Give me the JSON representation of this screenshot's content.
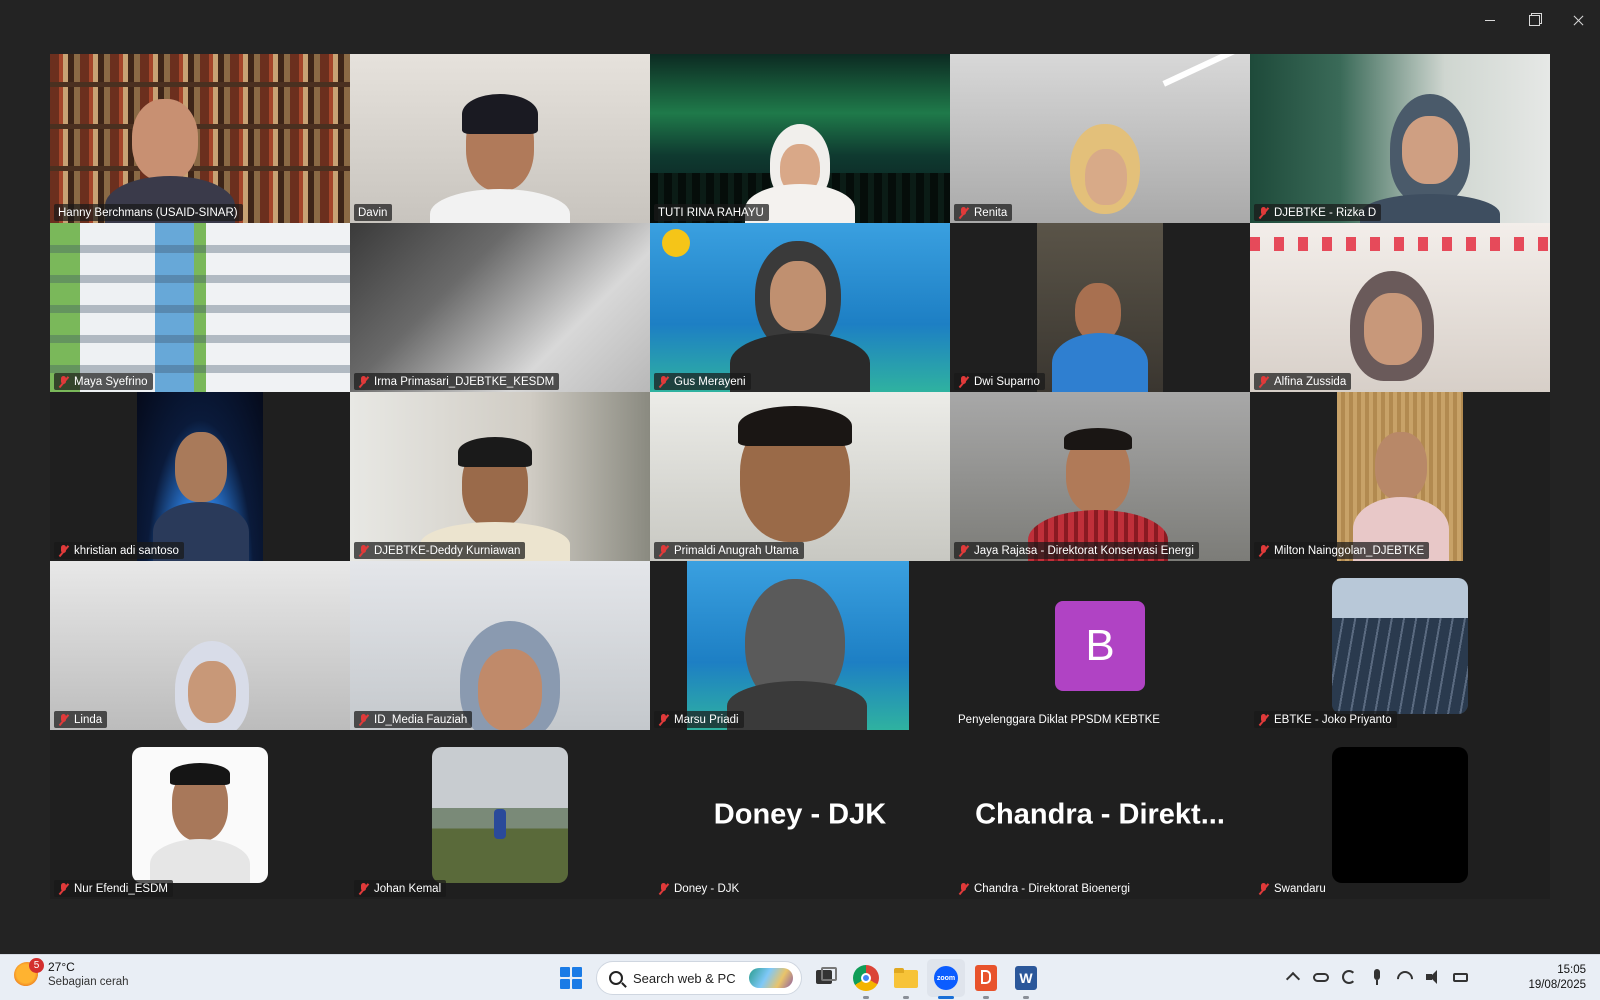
{
  "window": {
    "controls": [
      "minimize",
      "restore",
      "close"
    ]
  },
  "participants": [
    {
      "name": "Hanny Berchmans (USAID-SINAR)",
      "muted": false,
      "kind": "video"
    },
    {
      "name": "Davin",
      "muted": false,
      "kind": "video",
      "active_speaker": true
    },
    {
      "name": "TUTI RINA RAHAYU",
      "muted": false,
      "kind": "video"
    },
    {
      "name": "Renita",
      "muted": true,
      "kind": "video"
    },
    {
      "name": "DJEBTKE - Rizka D",
      "muted": true,
      "kind": "video"
    },
    {
      "name": "Maya Syefrino",
      "muted": true,
      "kind": "video"
    },
    {
      "name": "Irma Primasari_DJEBTKE_KESDM",
      "muted": true,
      "kind": "video"
    },
    {
      "name": "Gus Merayeni",
      "muted": true,
      "kind": "video"
    },
    {
      "name": "Dwi Suparno",
      "muted": true,
      "kind": "video"
    },
    {
      "name": "Alfina Zussida",
      "muted": true,
      "kind": "video"
    },
    {
      "name": "khristian adi santoso",
      "muted": true,
      "kind": "video"
    },
    {
      "name": "DJEBTKE-Deddy Kurniawan",
      "muted": true,
      "kind": "video"
    },
    {
      "name": "Primaldi Anugrah Utama",
      "muted": true,
      "kind": "video"
    },
    {
      "name": "Jaya Rajasa - Direktorat Konservasi Energi",
      "muted": true,
      "kind": "video"
    },
    {
      "name": "Milton Nainggolan_DJEBTKE",
      "muted": true,
      "kind": "video"
    },
    {
      "name": "Linda",
      "muted": true,
      "kind": "video"
    },
    {
      "name": "ID_Media Fauziah",
      "muted": true,
      "kind": "video"
    },
    {
      "name": "Marsu Priadi",
      "muted": true,
      "kind": "video"
    },
    {
      "name": "Penyelenggara Diklat PPSDM KEBTKE",
      "muted": false,
      "kind": "avatar",
      "avatar_letter": "B",
      "avatar_color": "#b043c4"
    },
    {
      "name": "EBTKE - Joko Priyanto",
      "muted": true,
      "kind": "photo"
    },
    {
      "name": "Nur Efendi_ESDM",
      "muted": true,
      "kind": "photo"
    },
    {
      "name": "Johan Kemal",
      "muted": true,
      "kind": "photo"
    },
    {
      "name": "Doney - DJK",
      "muted": true,
      "kind": "name",
      "display_name": "Doney - DJK"
    },
    {
      "name": "Chandra - Direktorat Bioenergi",
      "muted": true,
      "kind": "name",
      "display_name": "Chandra  -  Direkt..."
    },
    {
      "name": "Swandaru",
      "muted": true,
      "kind": "photo"
    }
  ],
  "taskbar": {
    "weather": {
      "temp": "27°C",
      "desc": "Sebagian cerah",
      "badge": "5"
    },
    "search_placeholder": "Search web & PC",
    "apps": [
      "file-explorer",
      "chrome",
      "folders",
      "zoom",
      "powerpoint-like",
      "word"
    ],
    "time": "15:05",
    "date": "19/08/2025"
  },
  "colors": {
    "active_speaker": "#23d959",
    "muted_icon": "#e03a3a",
    "accent": "#1a7be6"
  }
}
